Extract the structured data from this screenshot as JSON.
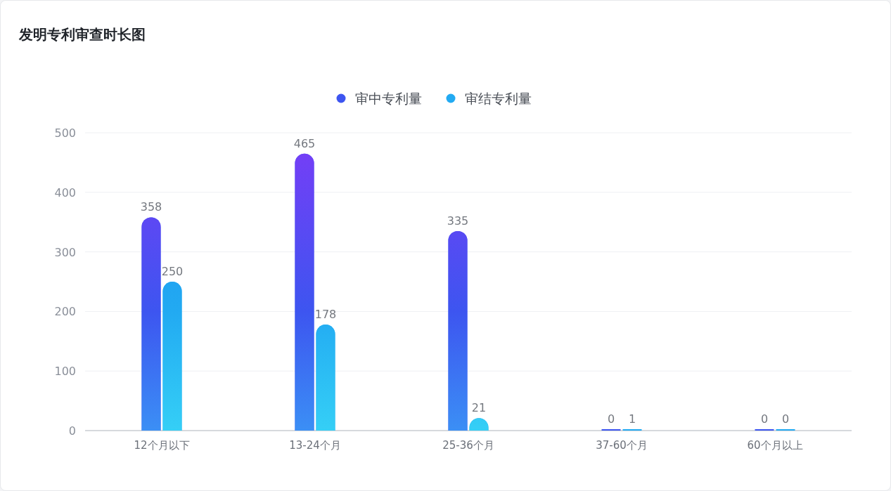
{
  "title": "发明专利审查时长图",
  "chart_data": {
    "type": "bar",
    "categories": [
      "12个月以下",
      "13-24个月",
      "25-36个月",
      "37-60个月",
      "60个月以上"
    ],
    "series": [
      {
        "name": "审中专利量",
        "color": "#3d55f0",
        "values": [
          358,
          465,
          335,
          0,
          0
        ]
      },
      {
        "name": "审结专利量",
        "color": "#22aaf2",
        "values": [
          250,
          178,
          21,
          1,
          0
        ]
      }
    ],
    "legend": true,
    "grid": true,
    "ylim": [
      0,
      500
    ],
    "yticks": [
      0,
      100,
      200,
      300,
      400,
      500
    ],
    "data_labels": true
  }
}
